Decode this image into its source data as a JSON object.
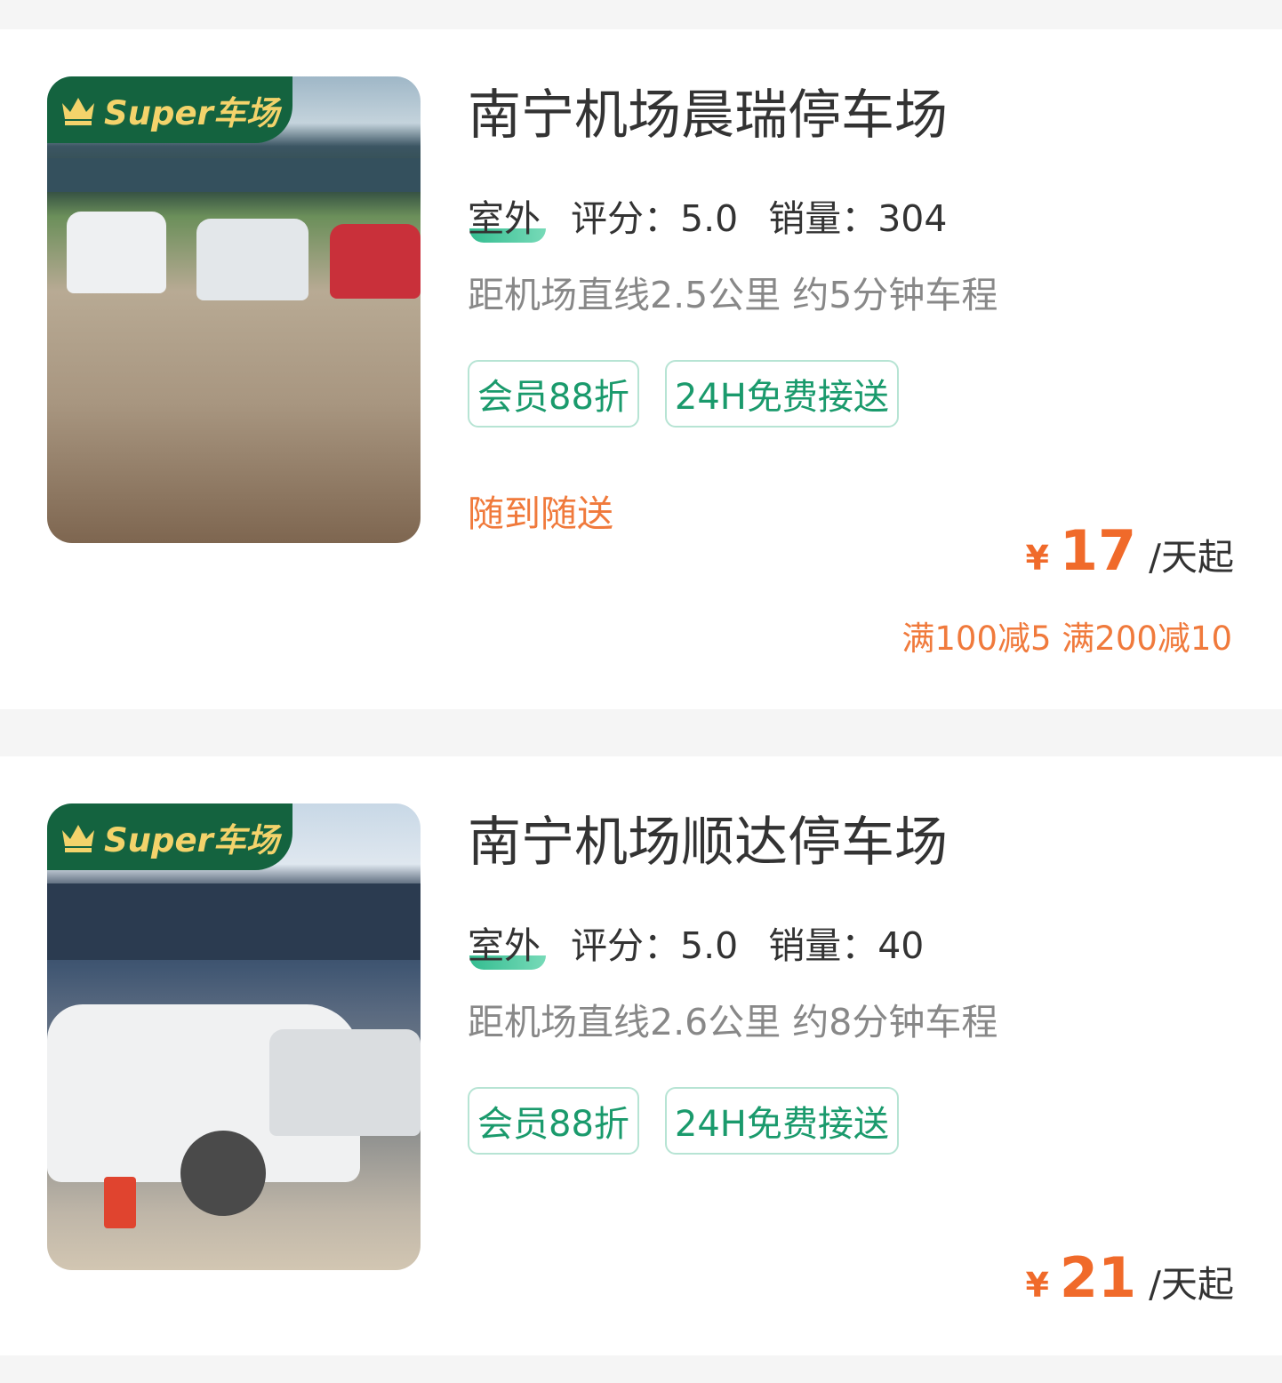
{
  "lots": [
    {
      "name": "南宁机场晨瑞停车场",
      "badge": "Super车场",
      "type": "室外",
      "rating": "评分：5.0",
      "sales": "销量：304",
      "distance": "距机场直线2.5公里 约5分钟车程",
      "tags": [
        "会员88折",
        "24H免费接送"
      ],
      "service": "随到随送",
      "currency": "¥",
      "price": "17",
      "unit": "/天起",
      "promo": "满100减5 满200减10"
    },
    {
      "name": "南宁机场顺达停车场",
      "badge": "Super车场",
      "type": "室外",
      "rating": "评分：5.0",
      "sales": "销量：40",
      "distance": "距机场直线2.6公里 约8分钟车程",
      "tags": [
        "会员88折",
        "24H免费接送"
      ],
      "currency": "¥",
      "price": "21",
      "unit": "/天起"
    }
  ],
  "colors": {
    "accent_orange": "#f06a2a",
    "tag_green": "#1a9a6c",
    "badge_green": "#14633f",
    "badge_gold": "#f3d36b"
  }
}
